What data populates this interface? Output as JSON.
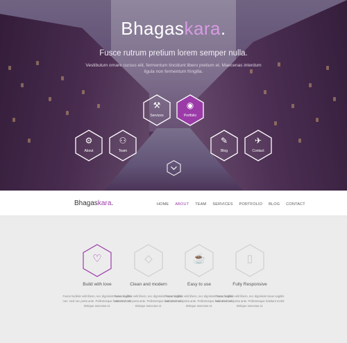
{
  "colors": {
    "accent": "#9b3ba8",
    "accent_light": "#d79ce3",
    "hero_overlay": "#5a3f63",
    "page_bg": "#ececec"
  },
  "hero": {
    "brand_primary": "Bhagas",
    "brand_accent": "kara",
    "brand_dot": ".",
    "tagline": "Fusce rutrum pretium lorem semper nulla.",
    "subline": "Vestibulum ornare cursus elit, fermentum tincidunt libero pretium et. Maecenas interdum ligula non fermentum fringilla.",
    "hex_nav": [
      {
        "label": "Services",
        "icon": "wrench-icon",
        "glyph": "⚒"
      },
      {
        "label": "Portfolio",
        "icon": "eye-icon",
        "glyph": "◉"
      },
      {
        "label": "About",
        "icon": "gear-icon",
        "glyph": "⚙"
      },
      {
        "label": "Team",
        "icon": "user-icon",
        "glyph": "⚇"
      },
      {
        "label": "Blog",
        "icon": "pencil-icon",
        "glyph": "✎"
      },
      {
        "label": "Contact",
        "icon": "paper-plane-icon",
        "glyph": "✈"
      }
    ],
    "scroll_glyph": "⌄"
  },
  "navbar": {
    "brand_primary": "Bhagas",
    "brand_accent": "kara",
    "brand_dot": ".",
    "links": [
      "HOME",
      "ABOUT",
      "TEAM",
      "SERVICES",
      "PORTFOLIO",
      "BLOG",
      "CONTACT"
    ],
    "active": "ABOUT"
  },
  "features": [
    {
      "title": "Build with love",
      "icon": "heart-icon",
      "glyph": "♡",
      "desc": "Fusce facilisis velit libero, nec dignissim lacus sagittis non. Sed nec porta ante. Pellentesque habitant morbi tristique senectus et."
    },
    {
      "title": "Clean and modern",
      "icon": "diamond-icon",
      "glyph": "◇",
      "desc": "Fusce facilisis velit libero, nec dignissim lacus sagittis non. Sed nec porta ante. Pellentesque habitant morbi tristique senectus et."
    },
    {
      "title": "Easy to use",
      "icon": "cup-icon",
      "glyph": "☕",
      "desc": "Fusce facilisis velit libero, nec dignissim lacus sagittis non. Sed nec porta ante. Pellentesque habitant morbi tristique senectus et."
    },
    {
      "title": "Fully Responsive",
      "icon": "tablet-icon",
      "glyph": "▯",
      "desc": "Fusce facilisis velit libero, nec dignissim lacus sagittis non. Sed nec porta ante. Pellentesque habitant morbi tristique senectus et."
    }
  ]
}
